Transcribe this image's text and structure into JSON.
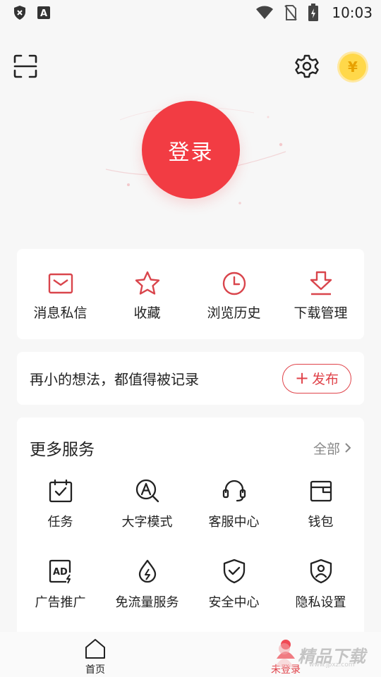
{
  "status_bar": {
    "time": "10:03",
    "icons": [
      "shield-x-icon",
      "a-box-icon",
      "wifi-icon",
      "no-sim-icon",
      "battery-charging-icon"
    ]
  },
  "toolbar": {
    "scan_icon": "scan-icon",
    "settings_icon": "gear-icon",
    "coin_symbol": "¥"
  },
  "login": {
    "label": "登录"
  },
  "quick_actions": [
    {
      "label": "消息私信",
      "icon": "mail-icon"
    },
    {
      "label": "收藏",
      "icon": "star-icon"
    },
    {
      "label": "浏览历史",
      "icon": "clock-icon"
    },
    {
      "label": "下载管理",
      "icon": "download-icon"
    }
  ],
  "post_prompt": {
    "text": "再小的想法，都值得被记录",
    "publish_plus": "+",
    "publish_label": "发布"
  },
  "services": {
    "title": "更多服务",
    "all_label": "全部",
    "items": [
      {
        "label": "任务",
        "icon": "task-calendar-icon"
      },
      {
        "label": "大字模式",
        "icon": "large-font-icon"
      },
      {
        "label": "客服中心",
        "icon": "headset-icon"
      },
      {
        "label": "钱包",
        "icon": "wallet-icon"
      },
      {
        "label": "广告推广",
        "icon": "ad-icon"
      },
      {
        "label": "免流量服务",
        "icon": "data-drop-icon"
      },
      {
        "label": "安全中心",
        "icon": "shield-check-icon"
      },
      {
        "label": "隐私设置",
        "icon": "privacy-shield-icon"
      }
    ]
  },
  "bottom_nav": {
    "home_label": "首页",
    "profile_label": "未登录"
  },
  "watermark": {
    "text": "精品下载",
    "sub": "www.jpxz.com"
  },
  "colors": {
    "accent": "#f23c43",
    "background": "#f7f7f7",
    "coin": "#ffd84a"
  }
}
